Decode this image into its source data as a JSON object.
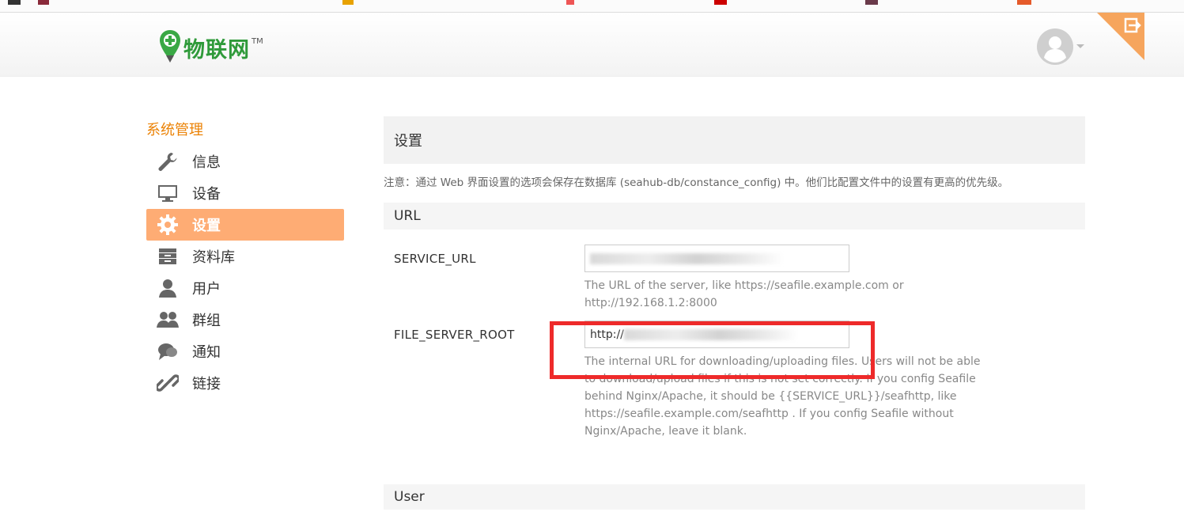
{
  "header": {
    "logo_text": "物联网",
    "logo_tm": "TM"
  },
  "sidebar": {
    "title": "系统管理",
    "items": [
      {
        "label": "信息",
        "icon": "wrench-icon"
      },
      {
        "label": "设备",
        "icon": "monitor-icon"
      },
      {
        "label": "设置",
        "icon": "gear-icon",
        "active": true
      },
      {
        "label": "资料库",
        "icon": "archive-icon"
      },
      {
        "label": "用户",
        "icon": "user-icon"
      },
      {
        "label": "群组",
        "icon": "users-icon"
      },
      {
        "label": "通知",
        "icon": "chat-icon"
      },
      {
        "label": "链接",
        "icon": "link-icon"
      }
    ]
  },
  "main": {
    "title": "设置",
    "notice": "注意：通过 Web 界面设置的选项会保存在数据库 (seahub-db/constance_config) 中。他们比配置文件中的设置有更高的优先级。",
    "sections": [
      {
        "title": "URL",
        "settings": [
          {
            "key": "SERVICE_URL",
            "value_visible": "",
            "help": "The URL of the server, like https://seafile.example.com or http://192.168.1.2:8000"
          },
          {
            "key": "FILE_SERVER_ROOT",
            "value_visible": "http://",
            "help": "The internal URL for downloading/uploading files. Users will not be able to download/upload files if this is not set correctly. If you config Seafile behind Nginx/Apache, it should be {{SERVICE_URL}}/seafhttp, like https://seafile.example.com/seafhttp . If you config Seafile without Nginx/Apache, leave it blank."
          }
        ]
      },
      {
        "title": "User"
      }
    ]
  },
  "colors": {
    "accent_orange": "#eb8205",
    "active_nav_bg": "#feac74",
    "highlight_red": "#ee2a2a",
    "logo_green": "#2f9a3a"
  }
}
